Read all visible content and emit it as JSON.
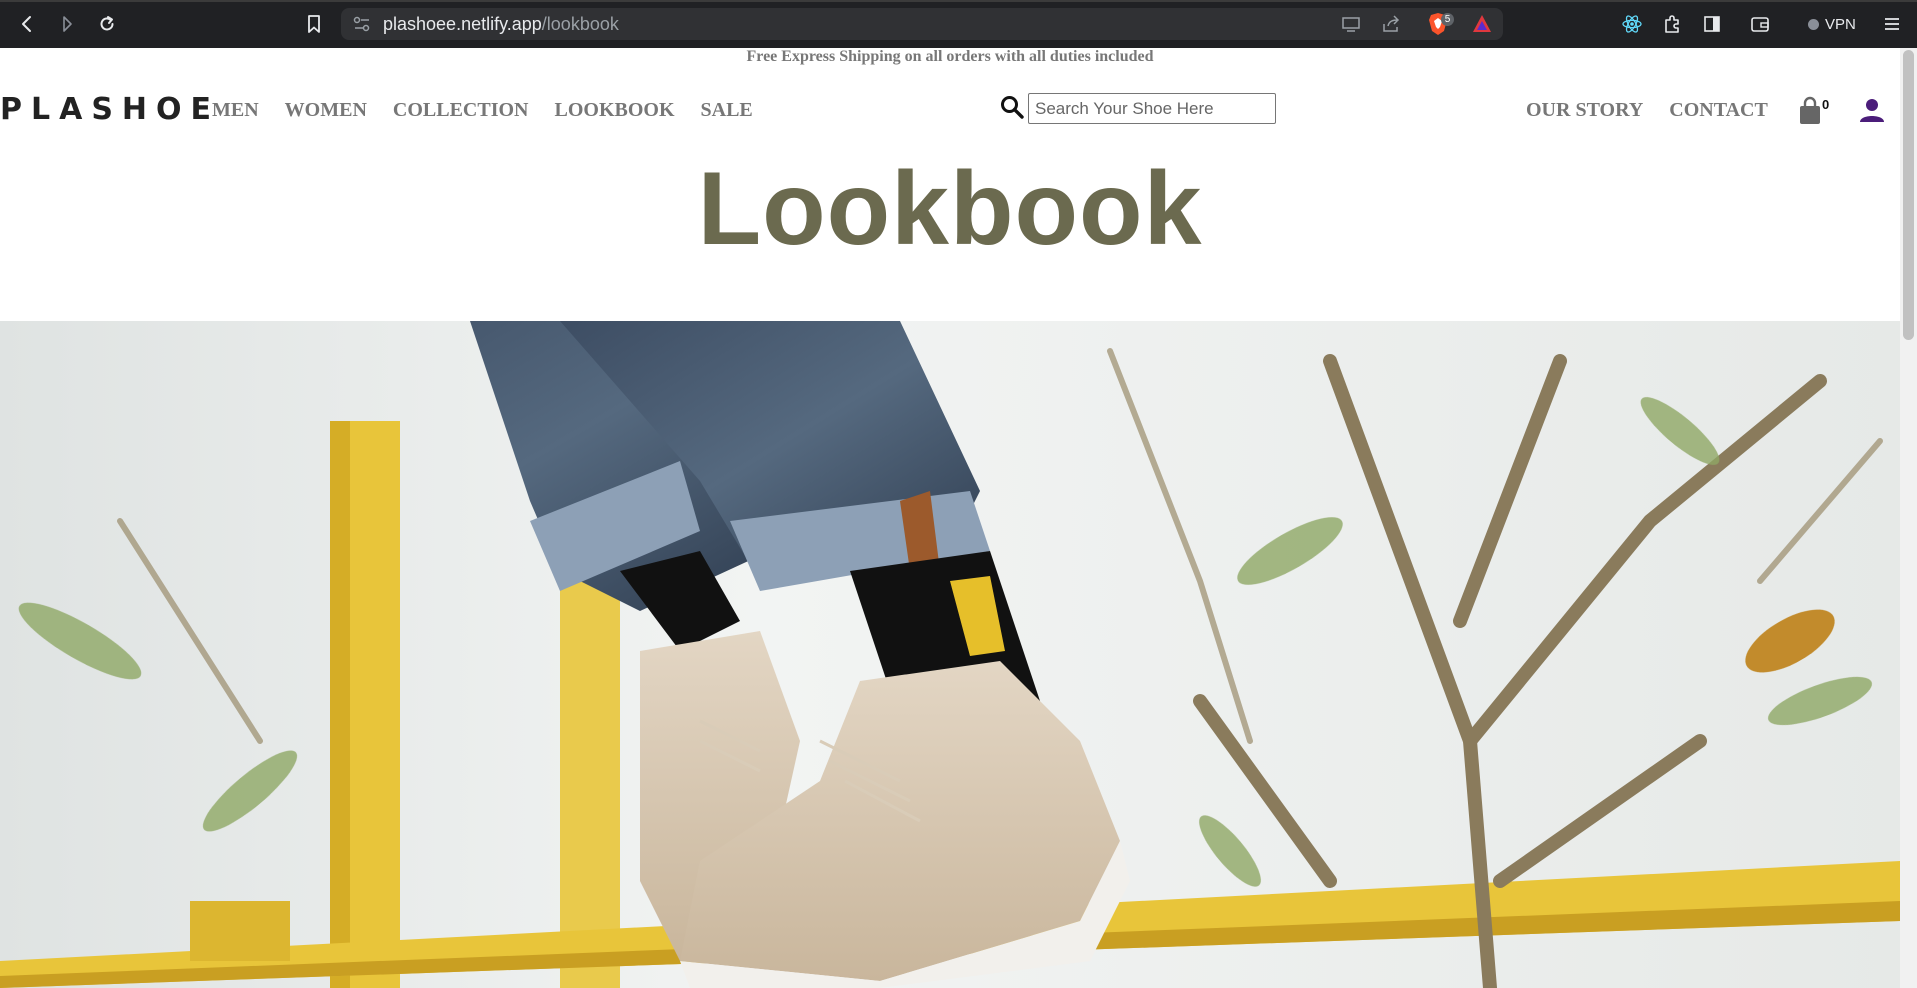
{
  "browser": {
    "url_host": "plashoee.netlify.app",
    "url_path": "/lookbook",
    "brave_badge_count": "5",
    "vpn_label": "VPN"
  },
  "site": {
    "shipping_banner": "Free Express Shipping on all orders with all duties included",
    "logo": "PLASHOE",
    "nav_left": [
      "MEN",
      "WOMEN",
      "COLLECTION",
      "LOOKBOOK",
      "SALE"
    ],
    "nav_right": [
      "OUR STORY",
      "CONTACT"
    ],
    "search_placeholder": "Search Your Shoe Here",
    "cart_count": "0"
  },
  "main": {
    "title": "Lookbook"
  },
  "colors": {
    "title": "#6b6a4f",
    "nav": "#777777",
    "user_icon": "#4b1d7a",
    "hero_rail": "#e8c53a"
  }
}
